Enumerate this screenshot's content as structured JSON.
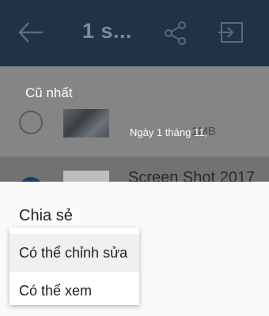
{
  "header": {
    "title": "1 s...",
    "back_icon": "back-arrow-icon",
    "share_icon": "share-icon",
    "move_icon": "move-icon"
  },
  "sort": {
    "label": "Cũ nhất"
  },
  "files": [
    {
      "name": "",
      "size": "1MB",
      "selected": false
    },
    {
      "name": "Screen Shot 2017",
      "size": "",
      "selected": true
    }
  ],
  "tooltip": {
    "text": "Ngày 1 tháng 11,"
  },
  "sheet": {
    "title": "Chia sẻ",
    "menu": [
      {
        "label": "Có thể chỉnh sửa"
      },
      {
        "label": "Có thể xem"
      }
    ]
  },
  "colors": {
    "header_bg": "#203246",
    "accent_selected": "#1b3c6d",
    "overlay_dim": "#7d7d7d"
  }
}
